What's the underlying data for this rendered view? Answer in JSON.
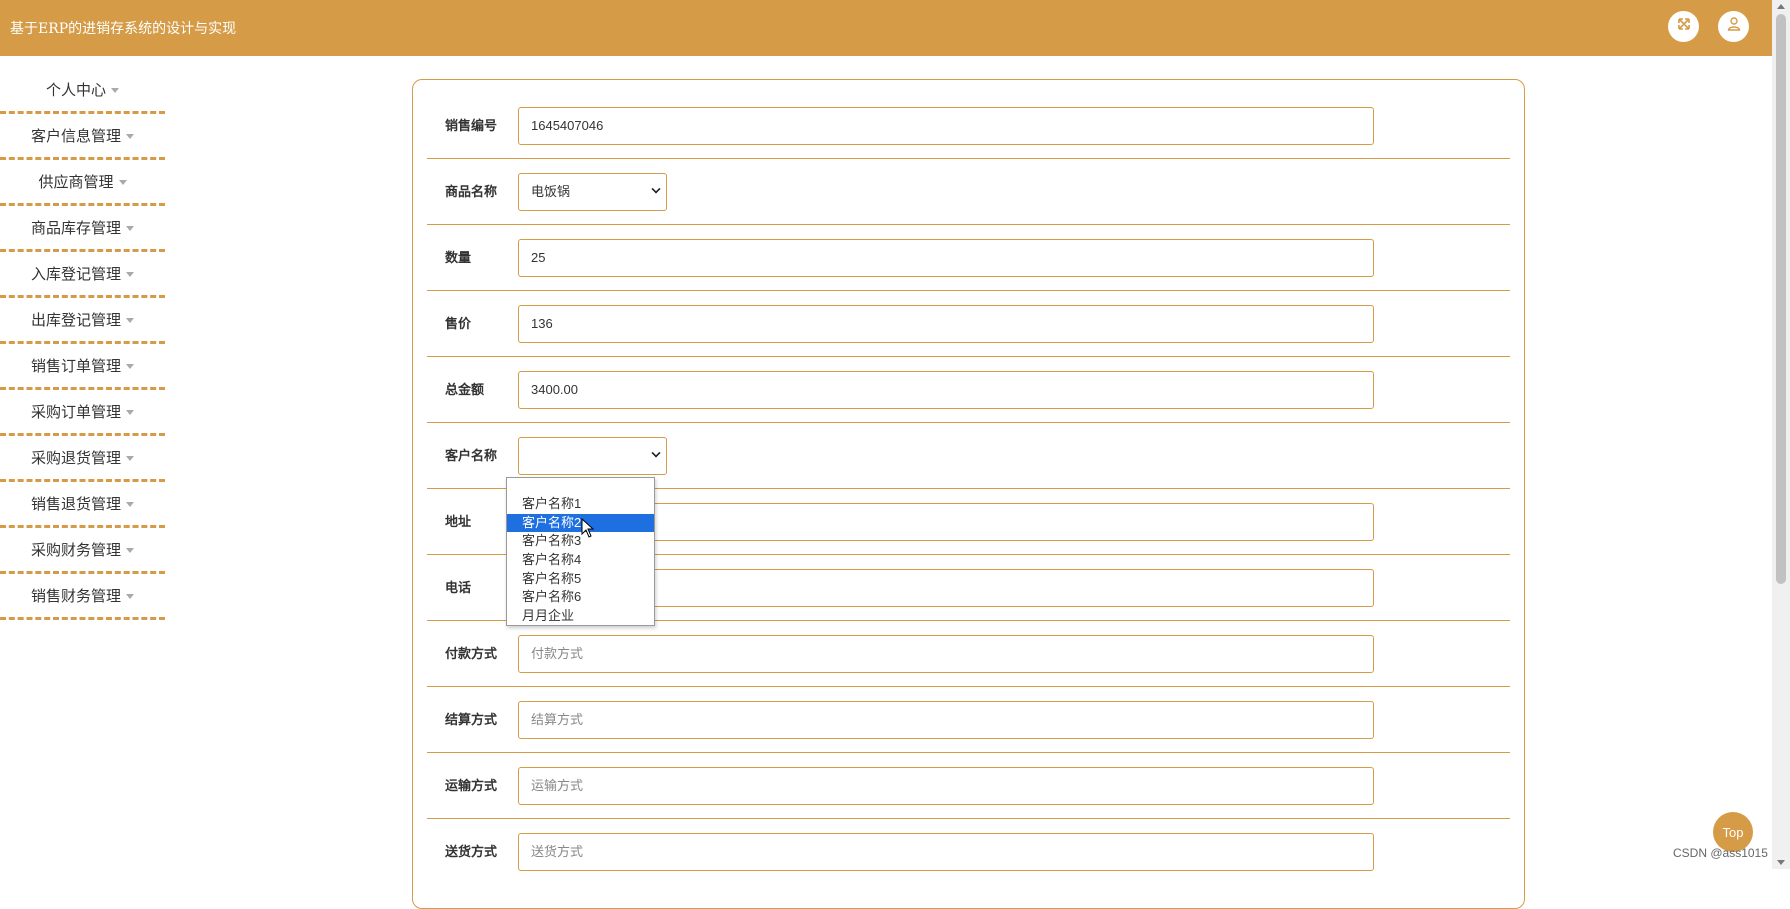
{
  "header": {
    "title": "基于ERP的进销存系统的设计与实现",
    "fullscreen_icon": "expand-icon",
    "user_icon": "user-icon"
  },
  "sidebar": {
    "items": [
      {
        "label": "个人中心"
      },
      {
        "label": "客户信息管理"
      },
      {
        "label": "供应商管理"
      },
      {
        "label": "商品库存管理"
      },
      {
        "label": "入库登记管理"
      },
      {
        "label": "出库登记管理"
      },
      {
        "label": "销售订单管理"
      },
      {
        "label": "采购订单管理"
      },
      {
        "label": "采购退货管理"
      },
      {
        "label": "销售退货管理"
      },
      {
        "label": "采购财务管理"
      },
      {
        "label": "销售财务管理"
      }
    ]
  },
  "form": {
    "sales_no": {
      "label": "销售编号",
      "value": "1645407046"
    },
    "product_name": {
      "label": "商品名称",
      "value": "电饭锅"
    },
    "quantity": {
      "label": "数量",
      "value": "25"
    },
    "price": {
      "label": "售价",
      "value": "136"
    },
    "total": {
      "label": "总金额",
      "value": "3400.00"
    },
    "customer_name": {
      "label": "客户名称",
      "value": ""
    },
    "address": {
      "label": "地址"
    },
    "phone": {
      "label": "电话"
    },
    "payment_method": {
      "label": "付款方式",
      "placeholder": "付款方式"
    },
    "settlement_method": {
      "label": "结算方式",
      "placeholder": "结算方式"
    },
    "shipping_method": {
      "label": "运输方式",
      "placeholder": "运输方式"
    },
    "delivery_method": {
      "label": "送货方式",
      "placeholder": "送货方式"
    }
  },
  "customer_dropdown": {
    "options": [
      "客户名称1",
      "客户名称2",
      "客户名称3",
      "客户名称4",
      "客户名称5",
      "客户名称6",
      "月月企业"
    ],
    "highlighted_index": 1,
    "highlight_color": "#1e6fe0"
  },
  "top_button": {
    "label": "Top"
  },
  "watermark": {
    "text": "CSDN @ass1015"
  },
  "colors": {
    "accent": "#d59b47"
  }
}
